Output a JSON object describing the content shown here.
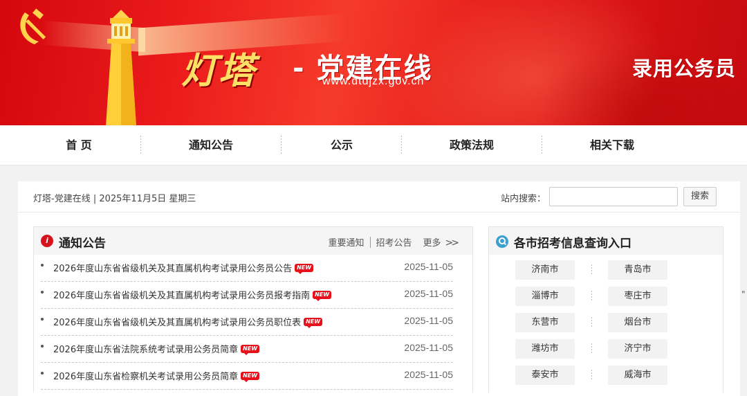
{
  "banner": {
    "logo_main": "灯塔",
    "logo_dash": "-",
    "logo_sub": "党建在线",
    "url": "www.dtdjzx.gov.cn",
    "title": "录用公务员"
  },
  "nav": {
    "items": [
      {
        "label": "首 页"
      },
      {
        "label": "通知公告"
      },
      {
        "label": "公示"
      },
      {
        "label": "政策法规"
      },
      {
        "label": "相关下载"
      }
    ]
  },
  "info_bar": {
    "text": "灯塔-党建在线 | 2025年11月5日 星期三",
    "search_label": "站内搜索：",
    "search_value": "",
    "search_button": "搜索"
  },
  "notice": {
    "icon": "notice-icon",
    "title": "通知公告",
    "link_important": "重要通知",
    "link_recruit": "招考公告",
    "more": "更多",
    "more_chevrons": ">>",
    "badge": "NEW",
    "items": [
      {
        "title": "2026年度山东省省级机关及其直属机构考试录用公务员公告",
        "date": "2025-11-05"
      },
      {
        "title": "2026年度山东省省级机关及其直属机构考试录用公务员报考指南",
        "date": "2025-11-05"
      },
      {
        "title": "2026年度山东省省级机关及其直属机构考试录用公务员职位表",
        "date": "2025-11-05"
      },
      {
        "title": "2026年度山东省法院系统考试录用公务员简章",
        "date": "2025-11-05"
      },
      {
        "title": "2026年度山东省检察机关考试录用公务员简章",
        "date": "2025-11-05"
      }
    ]
  },
  "cities": {
    "icon": "search-icon",
    "title": "各市招考信息查询入口",
    "rows": [
      [
        "济南市",
        "青岛市"
      ],
      [
        "淄博市",
        "枣庄市"
      ],
      [
        "东营市",
        "烟台市"
      ],
      [
        "潍坊市",
        "济宁市"
      ],
      [
        "泰安市",
        "威海市"
      ]
    ]
  },
  "edge_glyph": "\"",
  "colors": {
    "brand_red": "#d7121c",
    "banner_red": "#e21818",
    "accent_blue": "#3aa0d0",
    "logo_gold": "#ffe066"
  }
}
